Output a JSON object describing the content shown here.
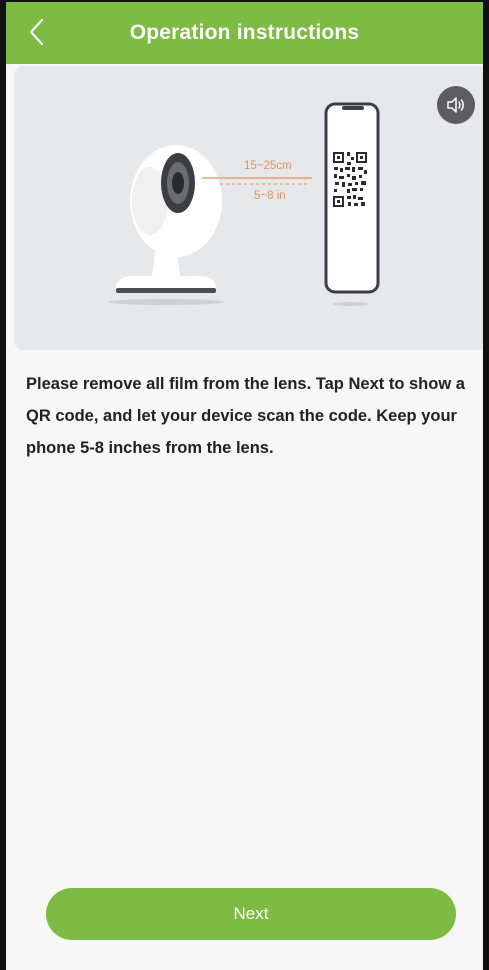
{
  "header": {
    "title": "Operation instructions",
    "back_icon": "chevron-left-icon"
  },
  "illustration": {
    "distance_cm": "15~25cm",
    "distance_in": "5~8 in",
    "sound_icon": "speaker-icon"
  },
  "instructions": {
    "text": "Please remove all film from the lens. Tap Next to show a QR code, and let your device scan the code. Keep your phone 5-8 inches from the lens."
  },
  "footer": {
    "next_label": "Next"
  },
  "colors": {
    "accent": "#7dbb42",
    "background": "#f7f7f7",
    "illustration_bg": "#e7e8ea",
    "distance_label": "#e8905a"
  }
}
